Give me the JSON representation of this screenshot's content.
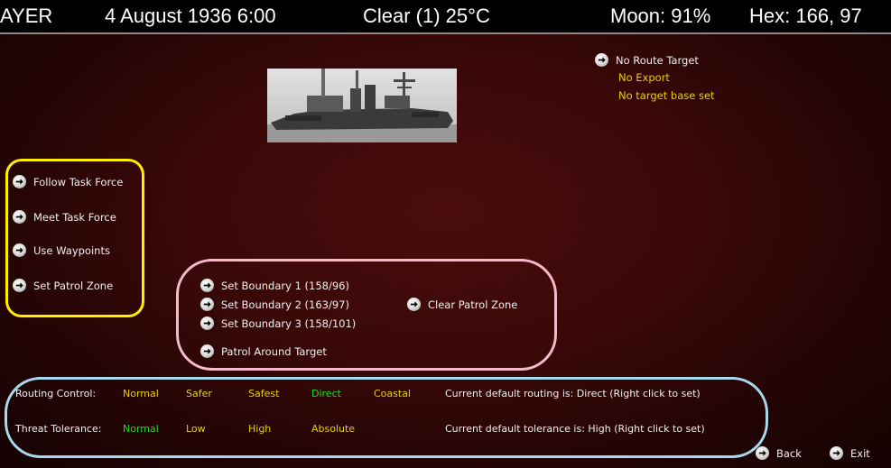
{
  "header": {
    "side": "AYER",
    "date": "4 August 1936 6:00",
    "weather": "Clear (1) 25°C",
    "moon": "Moon: 91%",
    "hex": "Hex: 166, 97"
  },
  "route_target": {
    "label": "No Route Target",
    "export": "No Export",
    "base": "No target base set"
  },
  "mission_buttons": [
    {
      "label": "Follow Task Force"
    },
    {
      "label": "Meet Task Force"
    },
    {
      "label": "Use Waypoints"
    },
    {
      "label": "Set Patrol Zone"
    }
  ],
  "patrol": {
    "boundary1": "Set Boundary 1 (158/96)",
    "boundary2": "Set Boundary 2 (163/97)",
    "boundary3": "Set Boundary 3 (158/101)",
    "around": "Patrol Around Target",
    "clear": "Clear Patrol Zone"
  },
  "routing": {
    "label": "Routing Control:",
    "options": [
      "Normal",
      "Safer",
      "Safest",
      "Direct",
      "Coastal"
    ],
    "selected": "Direct",
    "info": "Current default routing is: Direct (Right click to set)"
  },
  "threat": {
    "label": "Threat Tolerance:",
    "options": [
      "Normal",
      "Low",
      "High",
      "Absolute"
    ],
    "selected": "Normal",
    "info": "Current default tolerance is: High (Right click to set)"
  },
  "footer": {
    "back": "Back",
    "exit": "Exit"
  },
  "colors": {
    "option_default": "#e8d000",
    "option_selected": "#22dd22",
    "outline_yellow": "#ffee00",
    "outline_pink": "#f7b8cc",
    "outline_blue": "#a8d8ec"
  }
}
